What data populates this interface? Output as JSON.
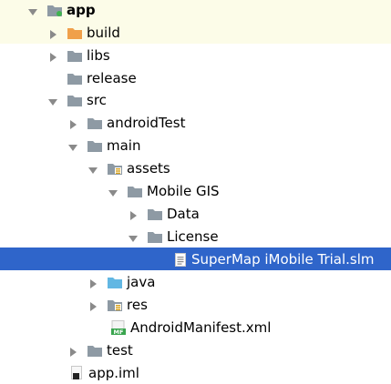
{
  "tree": {
    "app": {
      "label": "app"
    },
    "build": {
      "label": "build"
    },
    "libs": {
      "label": "libs"
    },
    "release": {
      "label": "release"
    },
    "src": {
      "label": "src"
    },
    "androidTest": {
      "label": "androidTest"
    },
    "main": {
      "label": "main"
    },
    "assets": {
      "label": "assets"
    },
    "mobile_gis": {
      "label": "Mobile GIS"
    },
    "data": {
      "label": "Data"
    },
    "license": {
      "label": "License"
    },
    "slm_file": {
      "label": "SuperMap iMobile Trial.slm"
    },
    "java": {
      "label": "java"
    },
    "res": {
      "label": "res"
    },
    "manifest": {
      "label": "AndroidManifest.xml",
      "badge": "MF"
    },
    "test": {
      "label": "test"
    },
    "app_iml": {
      "label": "app.iml"
    }
  },
  "colors": {
    "selection": "#2f65ca",
    "app_row_highlight": "#fcfce8",
    "folder_gray": "#8e9aa4",
    "folder_orange": "#f0a04a",
    "folder_blue": "#62b7e3",
    "arrow_gray": "#8a8a8a"
  }
}
